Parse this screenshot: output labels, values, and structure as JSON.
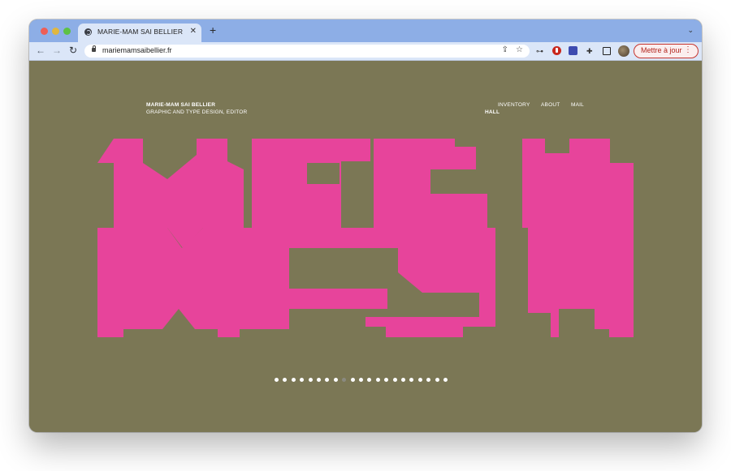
{
  "browser": {
    "tab": {
      "title": "MARIE-MAM SAI BELLIER",
      "close": "✕"
    },
    "new_tab": "+",
    "tab_menu": "⌄",
    "nav": {
      "back": "←",
      "forward": "→",
      "reload": "↻"
    },
    "url": "mariemamsaibellier.fr",
    "update_button": {
      "label": "Mettre à jour",
      "menu": "⋮"
    },
    "ext_key": "⊶",
    "ext_puzzle": "✚",
    "share_glyph": "⇪",
    "star_glyph": "☆"
  },
  "site": {
    "brand": {
      "name": "MARIE-MAM SAI BELLIER",
      "subtitle": "GRAPHIC AND TYPE DESIGN, EDITOR"
    },
    "menu": {
      "inventory": "INVENTORY",
      "about": "ABOUT",
      "mail": "MAIL",
      "hall": "HALL"
    },
    "artwork": {
      "colors": {
        "fill": "#e7449b",
        "background": "#7b7755"
      }
    },
    "carousel": {
      "count": 21,
      "active_index": 8
    }
  }
}
